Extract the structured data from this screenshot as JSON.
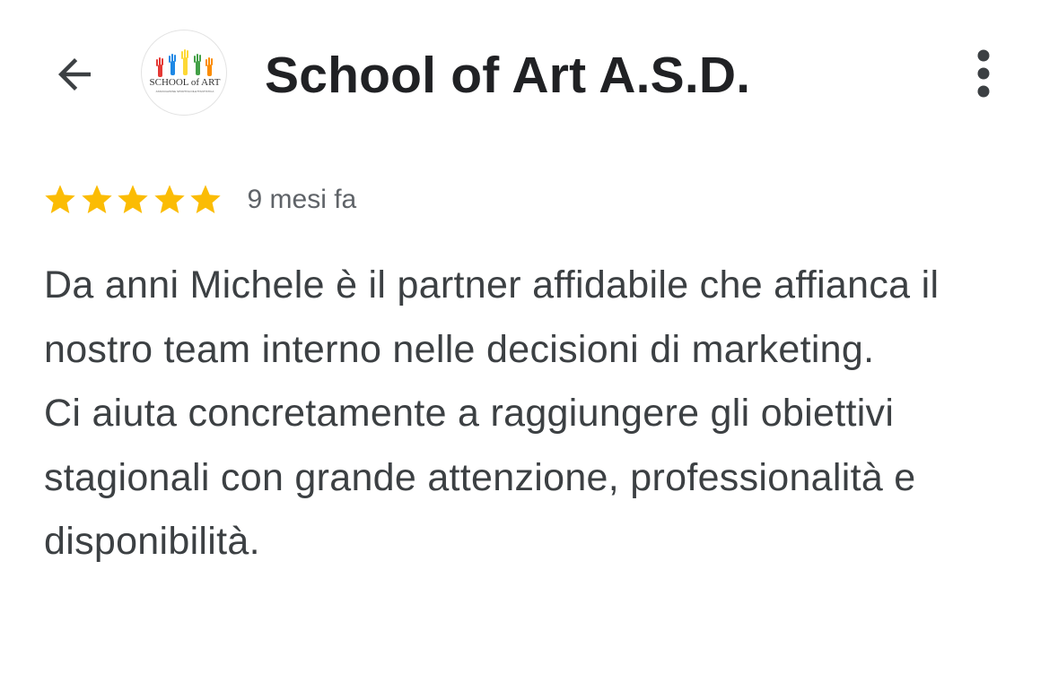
{
  "header": {
    "title": "School of Art A.S.D.",
    "back_icon": "arrow-left-icon",
    "more_icon": "more-vert-icon",
    "logo": {
      "text_main": "SCHOOL of ART",
      "text_sub": "ASSOCIAZIONE SPORTIVA DILETTANTISTICA"
    }
  },
  "review": {
    "rating": 5,
    "rating_max": 5,
    "star_color": "#fbbc04",
    "time_ago": "9 mesi fa",
    "paragraphs": [
      "Da anni Michele è il partner affidabile che affianca il nostro team interno nelle decisioni di marketing.",
      "Ci aiuta concretamente a raggiungere gli obiettivi stagionali con grande attenzione, professionalità e disponibilità."
    ]
  }
}
